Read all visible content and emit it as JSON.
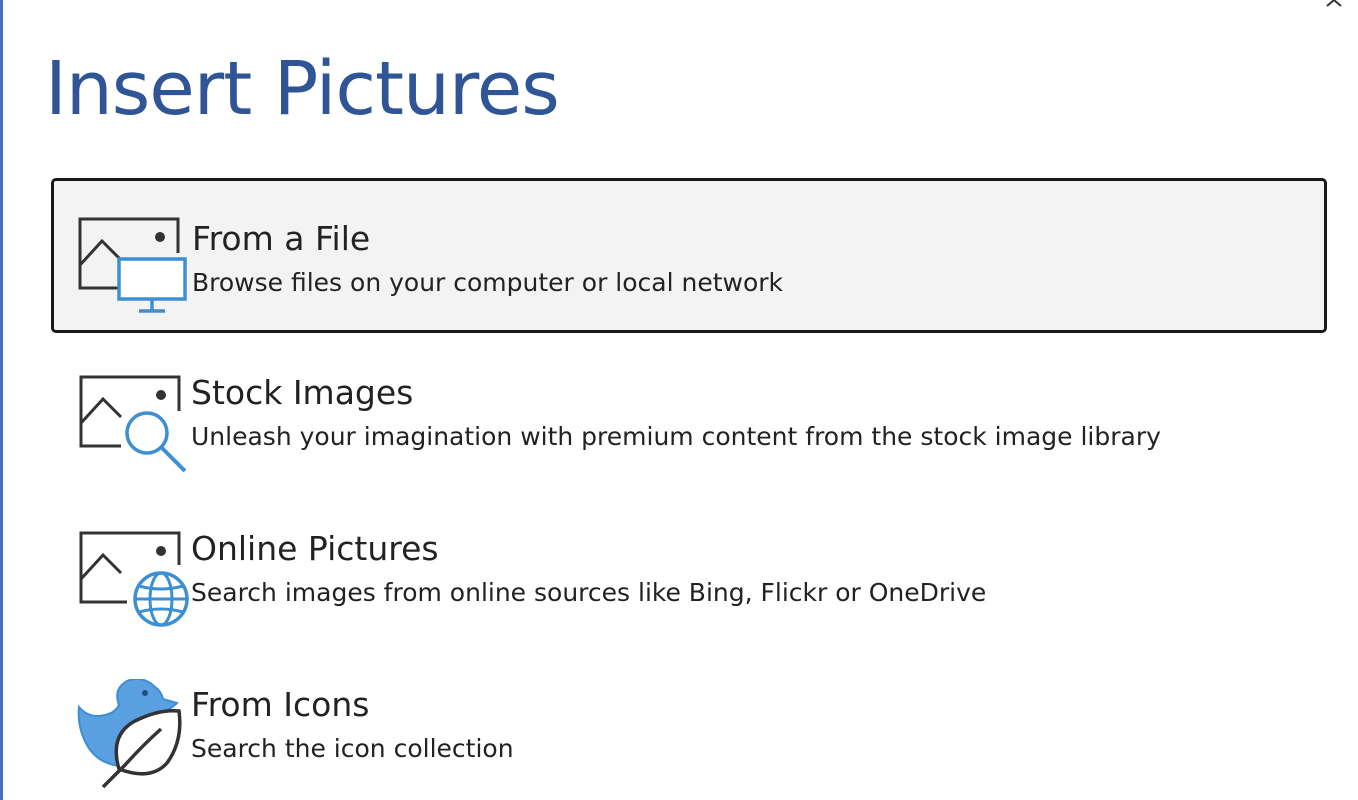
{
  "dialog": {
    "title": "Insert Pictures",
    "close_icon": "close-icon",
    "accent_color": "#2f5597",
    "icon_blue": "#3d8fd4"
  },
  "options": [
    {
      "name": "From a File",
      "description": "Browse files on your computer or local network",
      "icon": "picture-computer-icon",
      "selected": true
    },
    {
      "name": "Stock Images",
      "description": "Unleash your imagination with premium content from the stock image library",
      "icon": "picture-search-icon",
      "selected": false
    },
    {
      "name": "Online Pictures",
      "description": "Search images from online sources like Bing, Flickr or OneDrive",
      "icon": "picture-globe-icon",
      "selected": false
    },
    {
      "name": "From Icons",
      "description": "Search the icon collection",
      "icon": "duck-leaf-icon",
      "selected": false
    }
  ]
}
